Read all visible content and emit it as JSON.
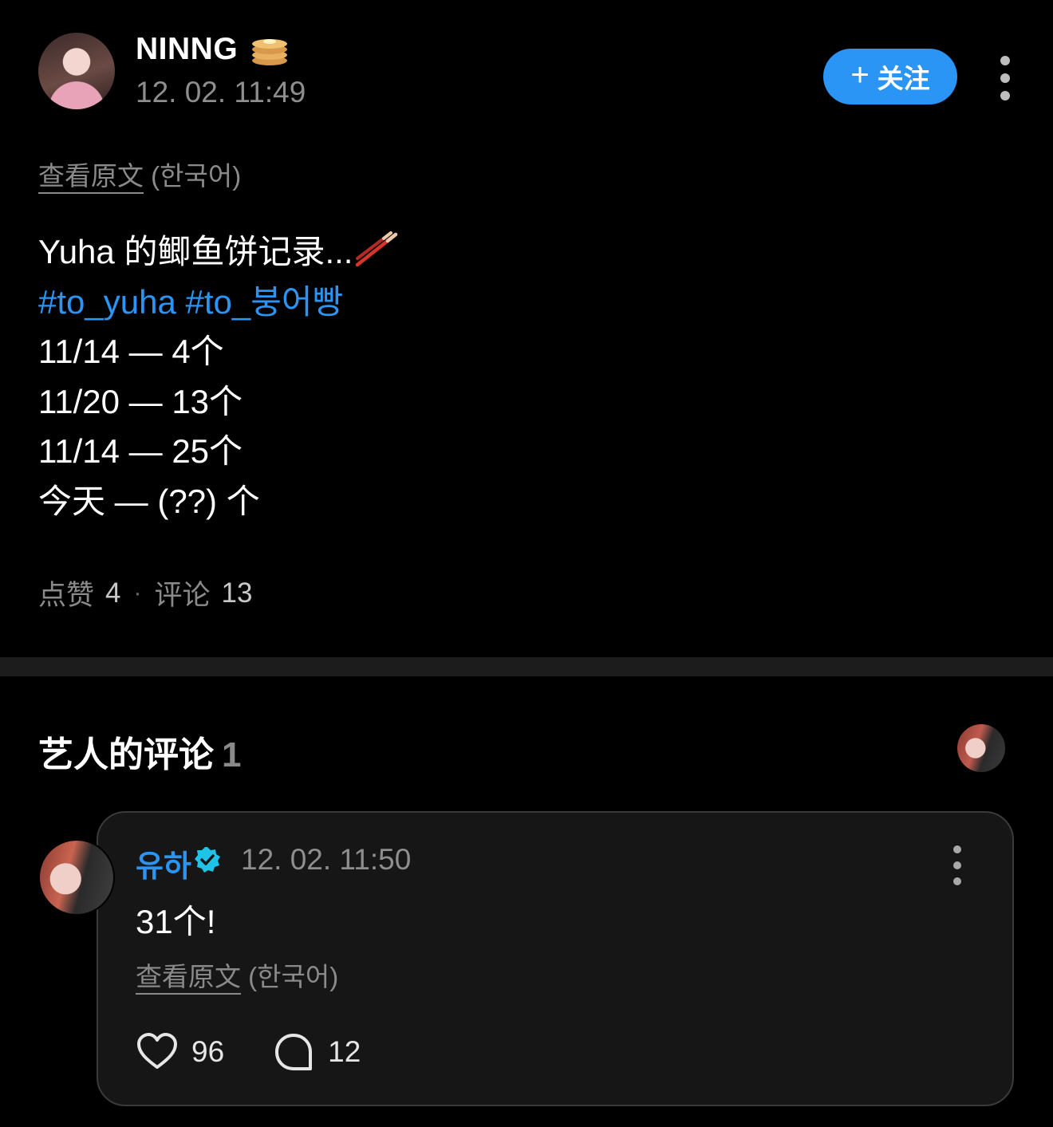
{
  "post": {
    "author": "NINNG",
    "timestamp": "12. 02. 11:49",
    "follow_label": "关注",
    "translate_link": "查看原文",
    "translate_lang": "(한국어)",
    "title_line": "Yuha 的鲫鱼饼记录...",
    "hashtags": [
      "#to_yuha",
      "#to_붕어빵"
    ],
    "lines": [
      "11/14 — 4个",
      "11/20 — 13个",
      "11/14 — 25个",
      "今天 — (??) 个"
    ],
    "likes_label": "点赞",
    "likes_count": "4",
    "comments_label": "评论",
    "comments_count": "13"
  },
  "artist_comments": {
    "title": "艺人的评论",
    "count": "1",
    "comment": {
      "author": "유하",
      "timestamp": "12. 02. 11:50",
      "text": "31个!",
      "translate_link": "查看原文",
      "translate_lang": "(한국어)",
      "likes": "96",
      "replies": "12"
    }
  },
  "colors": {
    "accent": "#2a95f5",
    "background": "#000000",
    "muted": "#8a8a8a",
    "card": "#161616"
  },
  "icons": [
    "pancake-icon",
    "plus-icon",
    "more-icon",
    "chopsticks-icon",
    "verified-icon",
    "heart-icon",
    "comment-icon"
  ]
}
